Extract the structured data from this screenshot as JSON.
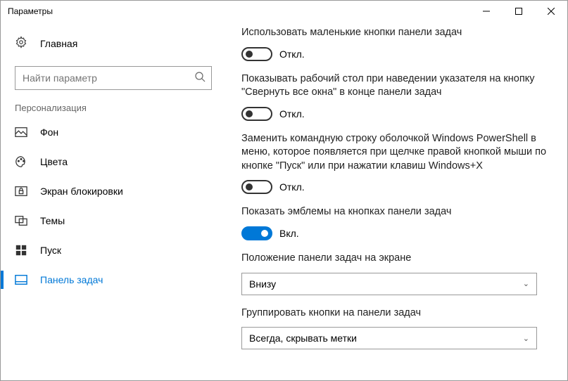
{
  "window": {
    "title": "Параметры"
  },
  "sidebar": {
    "home": "Главная",
    "search_placeholder": "Найти параметр",
    "section": "Персонализация",
    "items": [
      {
        "label": "Фон"
      },
      {
        "label": "Цвета"
      },
      {
        "label": "Экран блокировки"
      },
      {
        "label": "Темы"
      },
      {
        "label": "Пуск"
      },
      {
        "label": "Панель задач"
      }
    ]
  },
  "settings": {
    "s1": {
      "label": "Использовать маленькие кнопки панели задач",
      "state": "Откл."
    },
    "s2": {
      "label": "Показывать рабочий стол при наведении указателя на кнопку \"Свернуть все окна\" в конце панели задач",
      "state": "Откл."
    },
    "s3": {
      "label": "Заменить командную строку оболочкой Windows PowerShell в меню, которое появляется при щелчке правой кнопкой мыши по кнопке \"Пуск\" или при нажатии клавиш Windows+X",
      "state": "Откл."
    },
    "s4": {
      "label": "Показать эмблемы на кнопках панели задач",
      "state": "Вкл."
    },
    "s5": {
      "label": "Положение панели задач на экране",
      "value": "Внизу"
    },
    "s6": {
      "label": "Группировать кнопки на панели задач",
      "value": "Всегда, скрывать метки"
    }
  }
}
